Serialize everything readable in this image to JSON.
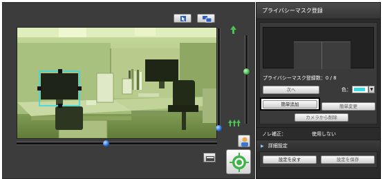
{
  "toolbar": {
    "select_icon": "cursor-select-icon",
    "monitor_icon": "multi-window-icon"
  },
  "panel": {
    "title": "プライバシーマスク登録",
    "count_label": "プライバシーマスク登録数：0 / 8",
    "next_button": "次へ",
    "color_label": "色：",
    "color_value": "#38d8e6",
    "easy_add_button": "簡単追加",
    "easy_change_button": "簡単変更",
    "delete_from_camera_button": "カメラから削除",
    "nr_label": "ノレ補正：",
    "nr_value": "使用しない",
    "advanced_label": "詳細設定",
    "restore_button": "設定を戻す",
    "save_button": "設定を保存"
  },
  "colors": {
    "mask_box": "#38d8e6",
    "slider_thumb": "#1e66d6",
    "green_indicator": "#3fb44a"
  }
}
